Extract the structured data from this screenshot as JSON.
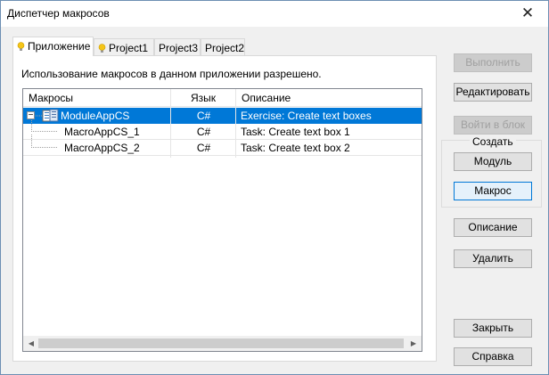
{
  "window": {
    "title": "Диспетчер макросов",
    "close_glyph": "✕"
  },
  "tabs": [
    {
      "label": "Приложение",
      "icon": "bulb-icon",
      "active": true
    },
    {
      "label": "Project1",
      "icon": "bulb-icon",
      "active": false
    },
    {
      "label": "Project3",
      "active": false
    },
    {
      "label": "Project2",
      "active": false
    }
  ],
  "info_text": "Использование макросов в данном приложении разрешено.",
  "tree": {
    "columns": [
      "Макросы",
      "Язык",
      "Описание"
    ],
    "rows": [
      {
        "name": "ModuleAppCS",
        "lang": "C#",
        "desc": "Exercise: Create text boxes",
        "expander": "−",
        "selected": true
      },
      {
        "name": "MacroAppCS_1",
        "lang": "C#",
        "desc": "Task: Create text box 1",
        "selected": false
      },
      {
        "name": "MacroAppCS_2",
        "lang": "C#",
        "desc": "Task: Create text box 2",
        "selected": false
      }
    ],
    "scroll_left": "◀",
    "scroll_right": "▶"
  },
  "buttons": {
    "run": "Выполнить",
    "edit": "Редактировать",
    "step_into": "Войти в блок",
    "create_group_label": "Создать",
    "module": "Модуль",
    "macro": "Макрос",
    "description": "Описание",
    "delete": "Удалить",
    "close": "Закрыть",
    "help": "Справка"
  },
  "colors": {
    "selection": "#0078d7",
    "focus_border": "#0078d7",
    "bulb": "#f5c518"
  }
}
